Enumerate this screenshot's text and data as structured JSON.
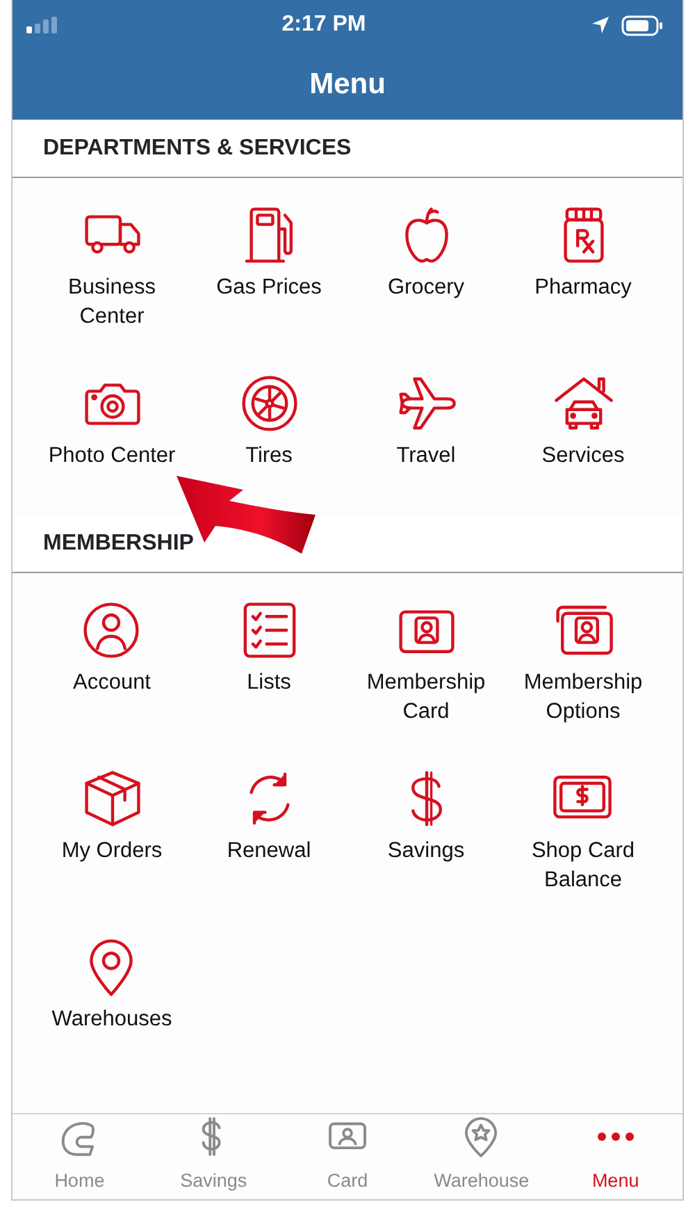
{
  "status_bar": {
    "time": "2:17 PM"
  },
  "header": {
    "title": "Menu"
  },
  "sections": [
    {
      "title": "DEPARTMENTS & SERVICES",
      "items": [
        {
          "label": "Business\nCenter"
        },
        {
          "label": "Gas Prices"
        },
        {
          "label": "Grocery"
        },
        {
          "label": "Pharmacy"
        },
        {
          "label": "Photo Center"
        },
        {
          "label": "Tires"
        },
        {
          "label": "Travel"
        },
        {
          "label": "Services"
        }
      ]
    },
    {
      "title": "MEMBERSHIP",
      "items": [
        {
          "label": "Account"
        },
        {
          "label": "Lists"
        },
        {
          "label": "Membership\nCard"
        },
        {
          "label": "Membership\nOptions"
        },
        {
          "label": "My Orders"
        },
        {
          "label": "Renewal"
        },
        {
          "label": "Savings"
        },
        {
          "label": "Shop Card\nBalance"
        },
        {
          "label": "Warehouses"
        }
      ]
    }
  ],
  "tab_bar": [
    {
      "label": "Home",
      "selected": false
    },
    {
      "label": "Savings",
      "selected": false
    },
    {
      "label": "Card",
      "selected": false
    },
    {
      "label": "Warehouse",
      "selected": false
    },
    {
      "label": "Menu",
      "selected": true
    }
  ]
}
